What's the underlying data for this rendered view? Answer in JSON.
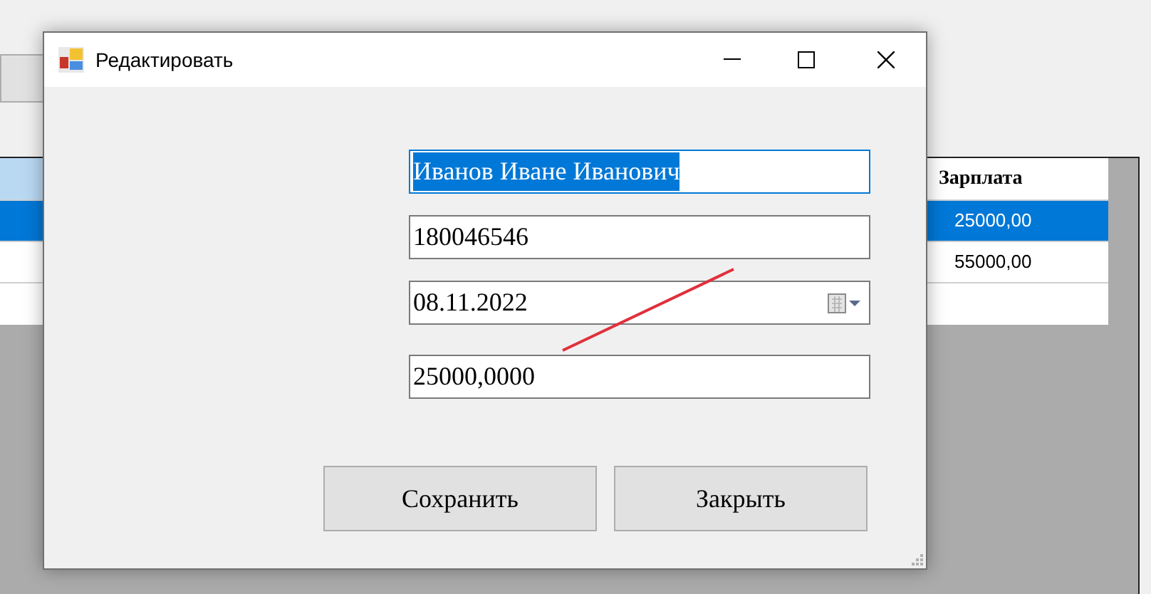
{
  "background_grid": {
    "columns": [
      {
        "label": "Зарплата"
      }
    ],
    "rows": [
      {
        "cells": [
          "25000,00"
        ],
        "selected": true
      },
      {
        "cells": [
          "55000,00"
        ],
        "selected": false
      }
    ]
  },
  "dialog": {
    "title": "Редактировать",
    "fields": [
      {
        "kind": "text",
        "value": "Иванов Иване Иванович",
        "selected": true
      },
      {
        "kind": "text",
        "value": "180046546",
        "selected": false
      },
      {
        "kind": "date",
        "value": "08.11.2022",
        "selected": false
      },
      {
        "kind": "text",
        "value": "25000,0000",
        "selected": false
      }
    ],
    "buttons": [
      "Сохранить",
      "Закрыть"
    ]
  }
}
